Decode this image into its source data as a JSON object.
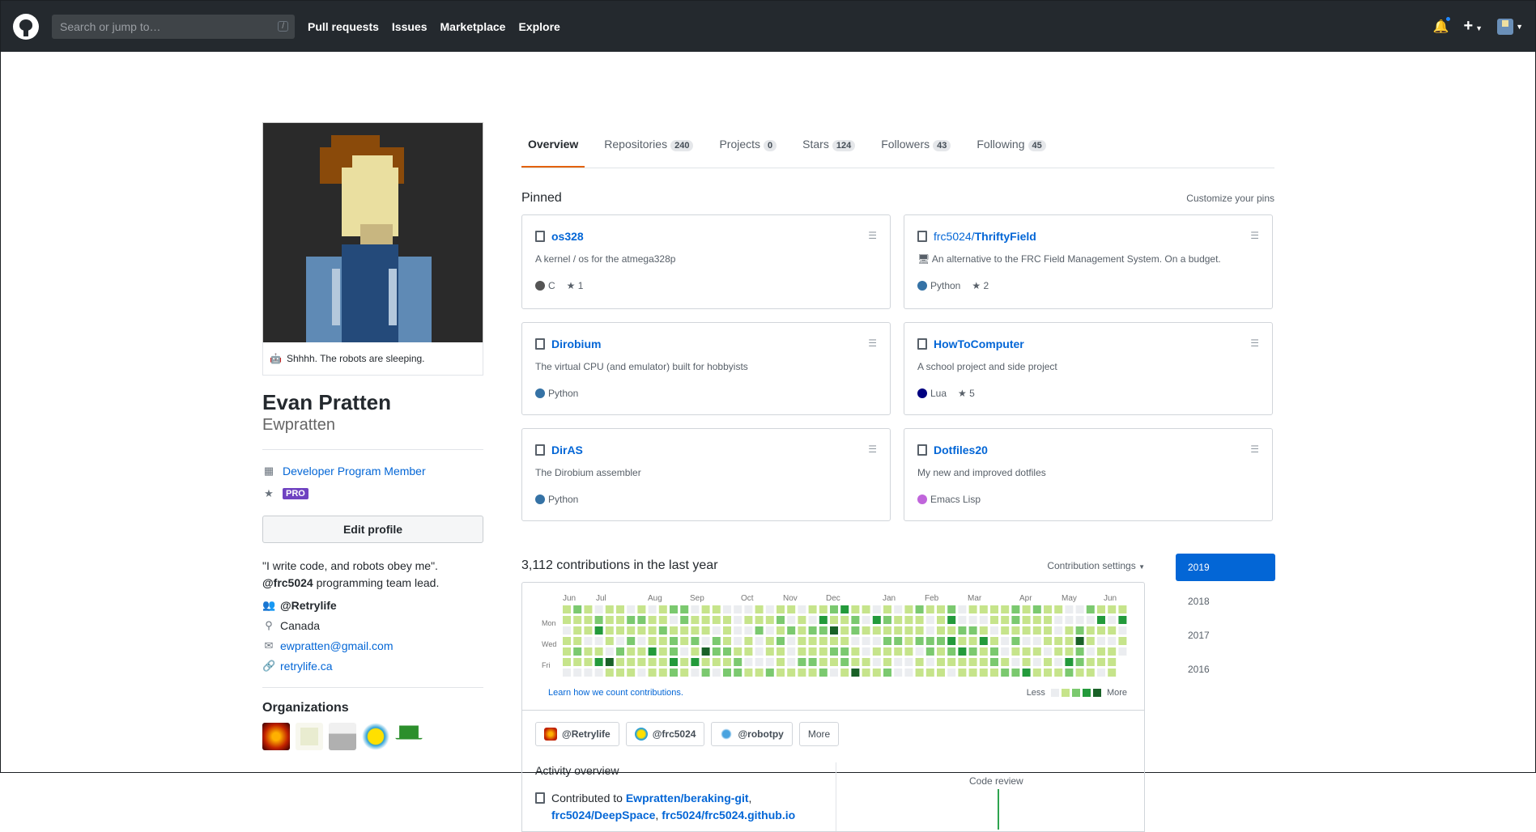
{
  "header": {
    "search_placeholder": "Search or jump to…",
    "search_key": "/",
    "nav": [
      "Pull requests",
      "Issues",
      "Marketplace",
      "Explore"
    ]
  },
  "profile": {
    "status": "Shhhh. The robots are sleeping.",
    "name": "Evan Pratten",
    "login": "Ewpratten",
    "dev_program": "Developer Program Member",
    "pro": "PRO",
    "edit_profile": "Edit profile",
    "bio_line1": "\"I write code, and robots obey me\".",
    "bio_mention": "@frc5024",
    "bio_rest": " programming team lead.",
    "company": "@Retrylife",
    "location": "Canada",
    "email": "ewpratten@gmail.com",
    "website": "retrylife.ca",
    "orgs_title": "Organizations"
  },
  "tabs": [
    {
      "label": "Overview",
      "count": ""
    },
    {
      "label": "Repositories",
      "count": "240"
    },
    {
      "label": "Projects",
      "count": "0"
    },
    {
      "label": "Stars",
      "count": "124"
    },
    {
      "label": "Followers",
      "count": "43"
    },
    {
      "label": "Following",
      "count": "45"
    }
  ],
  "pinned": {
    "title": "Pinned",
    "customize": "Customize your pins",
    "items": [
      {
        "owner": "",
        "name": "os328",
        "desc": "A kernel / os for the atmega328p",
        "lang": "C",
        "lang_color": "#555555",
        "stars": "1"
      },
      {
        "owner": "frc5024/",
        "name": "ThriftyField",
        "desc": "An alternative to the FRC Field Management System. On a budget.",
        "lang": "Python",
        "lang_color": "#3572A5",
        "stars": "2"
      },
      {
        "owner": "",
        "name": "Dirobium",
        "desc": "The virtual CPU (and emulator) built for hobbyists",
        "lang": "Python",
        "lang_color": "#3572A5",
        "stars": ""
      },
      {
        "owner": "",
        "name": "HowToComputer",
        "desc": "A school project and side project",
        "lang": "Lua",
        "lang_color": "#000080",
        "stars": "5"
      },
      {
        "owner": "",
        "name": "DirAS",
        "desc": "The Dirobium assembler",
        "lang": "Python",
        "lang_color": "#3572A5",
        "stars": ""
      },
      {
        "owner": "",
        "name": "Dotfiles20",
        "desc": "My new and improved dotfiles",
        "lang": "Emacs Lisp",
        "lang_color": "#c065db",
        "stars": ""
      }
    ]
  },
  "contributions": {
    "title": "3,112 contributions in the last year",
    "settings": "Contribution settings",
    "months": [
      "Jun",
      "Jul",
      "Aug",
      "Sep",
      "Oct",
      "Nov",
      "Dec",
      "Jan",
      "Feb",
      "Mar",
      "Apr",
      "May",
      "Jun"
    ],
    "days": [
      "Mon",
      "Wed",
      "Fri"
    ],
    "learn": "Learn how we count contributions.",
    "less": "Less",
    "more": "More",
    "colors": [
      "#ebedf0",
      "#c6e48b",
      "#7bc96f",
      "#239a3b",
      "#196127"
    ]
  },
  "activity": {
    "filters": [
      "@Retrylife",
      "@frc5024",
      "@robotpy"
    ],
    "more": "More",
    "overview_title": "Activity overview",
    "contributed_to": "Contributed to",
    "repo1": "Ewpratten/beraking-git",
    "repo2": "frc5024/DeepSpace",
    "repo3": "frc5024/frc5024.github.io",
    "code_review": "Code review"
  },
  "years": [
    "2019",
    "2018",
    "2017",
    "2016"
  ]
}
